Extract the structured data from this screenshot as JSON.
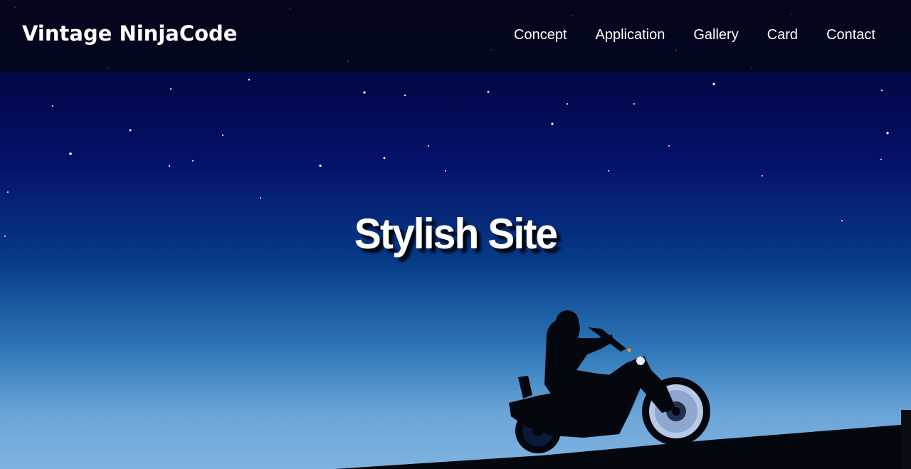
{
  "header": {
    "logo": "Vintage NinjaCode",
    "nav": [
      {
        "label": "Concept"
      },
      {
        "label": "Application"
      },
      {
        "label": "Gallery"
      },
      {
        "label": "Card"
      },
      {
        "label": "Contact"
      }
    ]
  },
  "hero": {
    "title": "Stylish Site"
  },
  "colors": {
    "header_bg": "#04061a",
    "sky_top": "#03074a",
    "sky_bottom": "#7fb3e0",
    "text": "#ffffff"
  }
}
